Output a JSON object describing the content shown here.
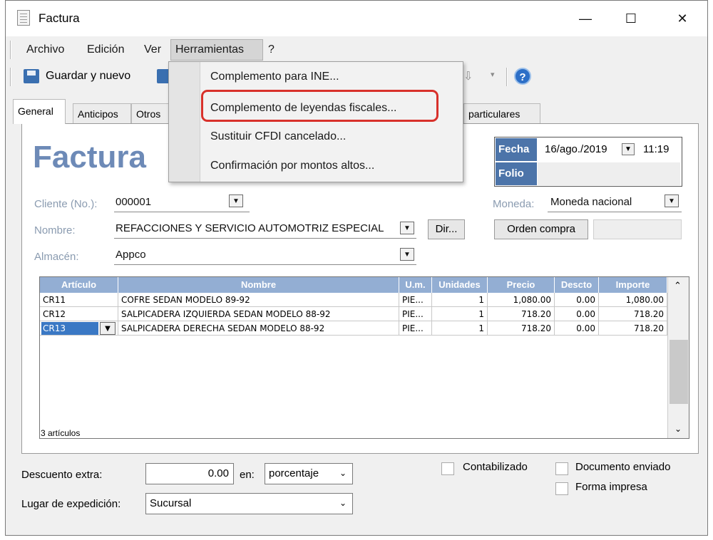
{
  "window": {
    "title": "Factura",
    "minimize": "—",
    "maximize": "☐",
    "close": "✕"
  },
  "menu": {
    "archivo": "Archivo",
    "edicion": "Edición",
    "ver": "Ver",
    "herramientas": "Herramientas",
    "help": "?"
  },
  "toolbar": {
    "save_new": "Guardar y nuevo",
    "help_icon": "?"
  },
  "herramientas_menu": {
    "items": [
      "Complemento para INE...",
      "Complemento de leyendas fiscales...",
      "Sustituir CFDI cancelado...",
      "Confirmación por montos altos..."
    ],
    "highlighted_index": 1
  },
  "tabs": {
    "general": "General",
    "anticipos": "Anticipos",
    "otros": "Otros",
    "particulares": "particulares"
  },
  "doc": {
    "title": "Factura"
  },
  "fecha": {
    "label": "Fecha",
    "value": "16/ago./2019",
    "time": "11:19",
    "folio_label": "Folio",
    "folio_value": ""
  },
  "form": {
    "cliente_label": "Cliente (No.):",
    "cliente_value": "000001",
    "nombre_label": "Nombre:",
    "nombre_value": "REFACCIONES Y SERVICIO AUTOMOTRIZ ESPECIAL",
    "almacen_label": "Almacén:",
    "almacen_value": "Appco",
    "dir_button": "Dir...",
    "moneda_label": "Moneda:",
    "moneda_value": "Moneda nacional",
    "orden_button": "Orden compra"
  },
  "grid": {
    "headers": [
      "Artículo",
      "Nombre",
      "U.m.",
      "Unidades",
      "Precio",
      "Descto",
      "Importe"
    ],
    "rows": [
      [
        "CR11",
        "COFRE SEDAN MODELO 89-92",
        "PIE...",
        "1",
        "1,080.00",
        "0.00",
        "1,080.00"
      ],
      [
        "CR12",
        "SALPICADERA IZQUIERDA SEDAN MODELO 88-92",
        "PIE...",
        "1",
        "718.20",
        "0.00",
        "718.20"
      ],
      [
        "CR13",
        "SALPICADERA DERECHA SEDAN MODELO 88-92",
        "PIE...",
        "1",
        "718.20",
        "0.00",
        "718.20"
      ]
    ],
    "selected_row": 2,
    "count": "3 artículos"
  },
  "bottom": {
    "descuento_label": "Descuento extra:",
    "descuento_value": "0.00",
    "en_label": "en:",
    "en_value": "porcentaje",
    "lugar_label": "Lugar de expedición:",
    "lugar_value": "Sucursal",
    "contabilizado": "Contabilizado",
    "documento_enviado": "Documento enviado",
    "forma_impresa": "Forma impresa"
  },
  "colors": {
    "accent_blue": "#4c74a9",
    "grid_header": "#93aed3",
    "highlight_red": "#d8312b",
    "title_blue": "#6d8ab7",
    "selection": "#3a78c4"
  }
}
